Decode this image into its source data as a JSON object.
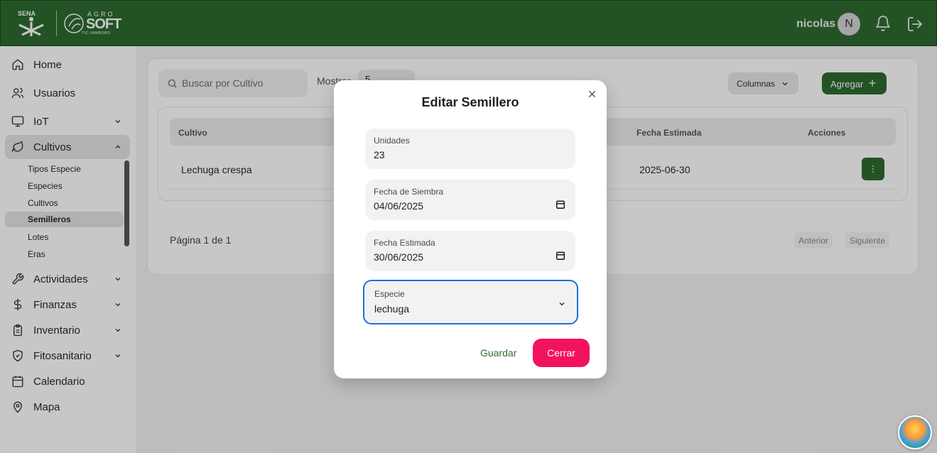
{
  "header": {
    "logo_sena": "SENA",
    "logo_agro_top": "AGRO",
    "logo_agro_main": "SOFT",
    "logo_agro_sub": "TIC-YAMBORO",
    "user_name": "nicolas",
    "avatar_initial": "N",
    "bg_color": "#2e6b30"
  },
  "sidebar": {
    "items": [
      {
        "label": "Home",
        "icon": "home-icon"
      },
      {
        "label": "Usuarios",
        "icon": "users-icon"
      },
      {
        "label": "IoT",
        "icon": "monitor-icon"
      },
      {
        "label": "Cultivos",
        "icon": "leaf-icon"
      },
      {
        "label": "Actividades",
        "icon": "wrench-icon"
      },
      {
        "label": "Finanzas",
        "icon": "dollar-icon"
      },
      {
        "label": "Inventario",
        "icon": "clipboard-icon"
      },
      {
        "label": "Fitosanitario",
        "icon": "shield-icon"
      },
      {
        "label": "Calendario",
        "icon": "calendar-icon"
      },
      {
        "label": "Mapa",
        "icon": "map-pin-icon"
      }
    ],
    "cultivos_sub": [
      "Tipos Especie",
      "Especies",
      "Cultivos",
      "Semilleros",
      "Lotes",
      "Eras"
    ]
  },
  "toolbar": {
    "search_placeholder": "Buscar por Cultivo",
    "mostrar_label": "Mostrar",
    "mostrar_value": "5",
    "columnas_label": "Columnas",
    "agregar_label": "Agregar"
  },
  "table": {
    "headers": {
      "cultivo": "Cultivo",
      "fecha_estimada": "Fecha Estimada",
      "acciones": "Acciones"
    },
    "rows": [
      {
        "cultivo": "Lechuga crespa",
        "fecha_estimada": "2025-06-30"
      }
    ]
  },
  "pagination": {
    "info": "Página 1 de 1",
    "prev": "Anterior",
    "next": "Siguiente"
  },
  "modal": {
    "title": "Editar Semillero",
    "fields": [
      {
        "label": "Unidades",
        "value": "23"
      },
      {
        "label": "Fecha de Siembra",
        "value": "04/06/2025"
      },
      {
        "label": "Fecha Estimada",
        "value": "30/06/2025"
      },
      {
        "label": "Especie",
        "value": "lechuga"
      }
    ],
    "save_label": "Guardar",
    "close_label": "Cerrar",
    "close_color": "#f31260",
    "focus_color": "#1a73d9"
  }
}
